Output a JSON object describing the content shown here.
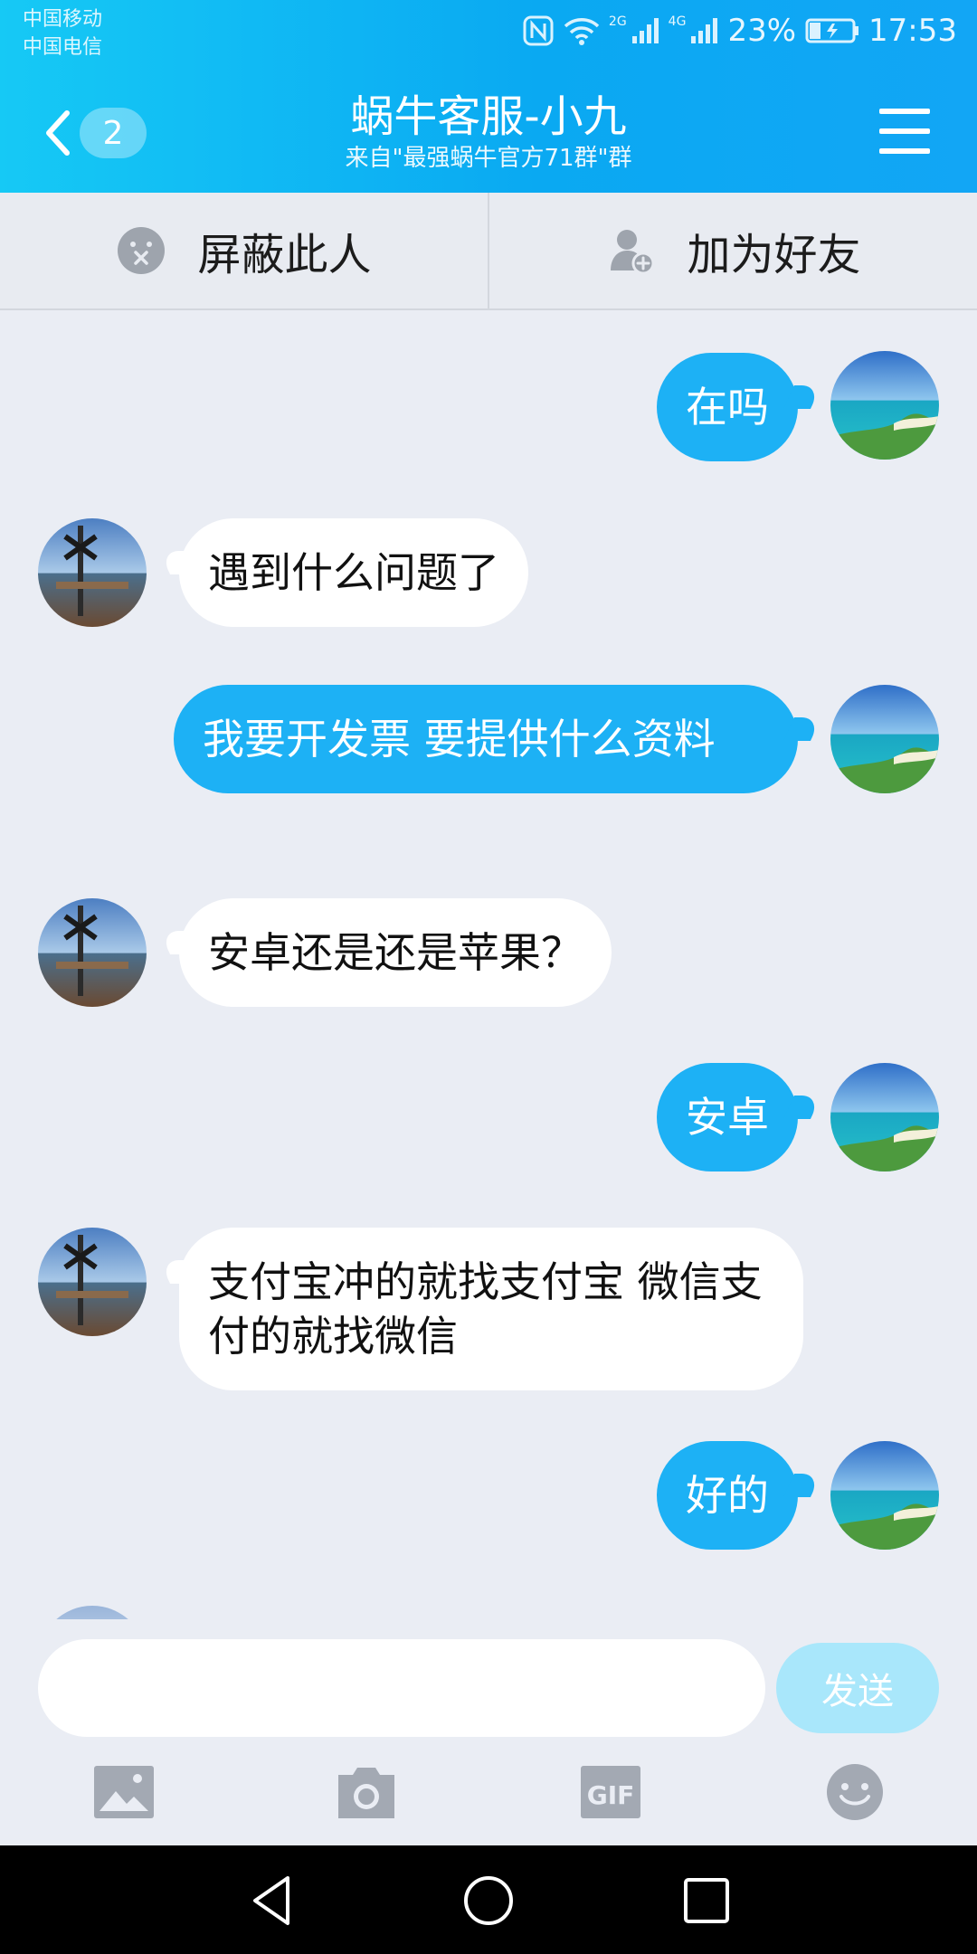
{
  "status_bar": {
    "carrier_1": "中国移动",
    "carrier_2": "中国电信",
    "network_1": "2G",
    "network_2": "4G",
    "battery": "23%",
    "time": "17:53"
  },
  "header": {
    "unread_count": "2",
    "title": "蜗牛客服-小九",
    "subtitle": "来自\"最强蜗牛官方71群\"群",
    "back_icon": "chevron-left-icon",
    "menu_icon": "hamburger-icon"
  },
  "actions": {
    "block_label": "屏蔽此人",
    "add_friend_label": "加为好友"
  },
  "messages": [
    {
      "side": "me",
      "text": "在吗"
    },
    {
      "side": "them",
      "text": "遇到什么问题了"
    },
    {
      "side": "me",
      "text": "我要开发票  要提供什么资料"
    },
    {
      "side": "them",
      "text": "安卓还是还是苹果？"
    },
    {
      "side": "me",
      "text": "安卓"
    },
    {
      "side": "them",
      "text": "支付宝冲的就找支付宝   微信支付的就找微信"
    },
    {
      "side": "me",
      "text": "好的"
    }
  ],
  "input": {
    "value": "",
    "placeholder": "",
    "send_label": "发送",
    "gif_label": "GIF"
  },
  "colors": {
    "header_start": "#16c9f5",
    "header_end": "#12a6f5",
    "my_bubble": "#1db1f5",
    "send_disabled": "#a9e7fb",
    "background": "#eaedf4"
  }
}
